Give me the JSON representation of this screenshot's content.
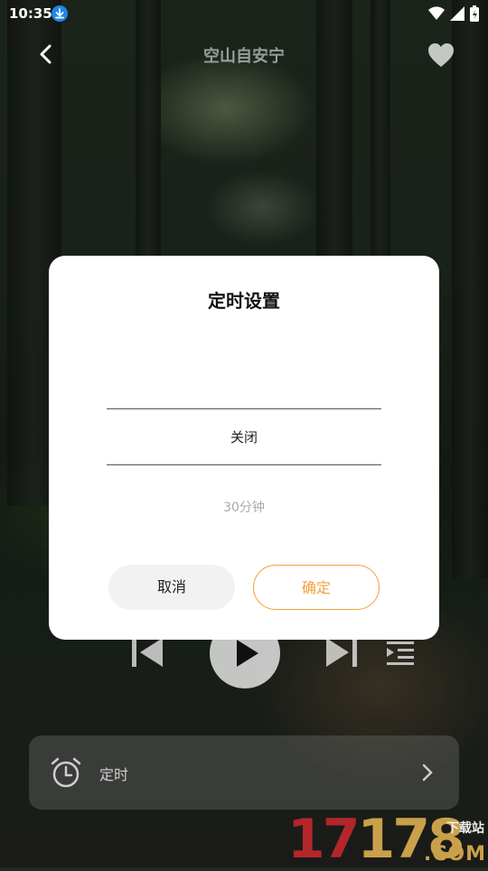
{
  "status_bar": {
    "time": "10:35"
  },
  "header": {
    "title": "空山自安宁"
  },
  "timer_bar": {
    "label": "定时"
  },
  "dialog": {
    "title": "定时设置",
    "selected_option": "关闭",
    "next_option": "30分钟",
    "cancel_label": "取消",
    "confirm_label": "确定"
  },
  "watermark": {
    "number": "17178",
    "site": "下载站",
    "domain": ".COM"
  },
  "colors": {
    "accent": "#f0a23a",
    "download_badge": "#1e88e5",
    "watermark_red": "#b3262a",
    "watermark_gold": "#c9a14a"
  }
}
